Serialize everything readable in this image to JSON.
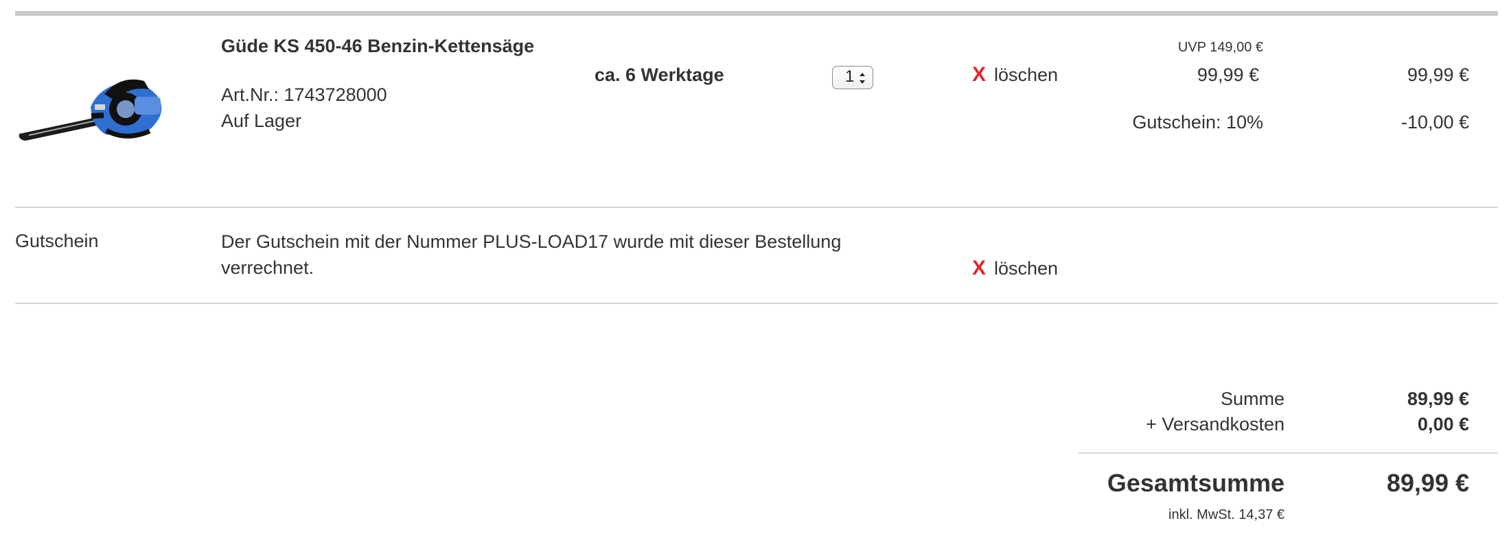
{
  "cart": {
    "item": {
      "title": "Güde KS 450-46 Benzin-Kettensäge",
      "article_number": "Art.Nr.: 1743728000",
      "stock_status": "Auf Lager",
      "delivery_time": "ca. 6 Werktage",
      "quantity": "1",
      "delete_label": "löschen",
      "delete_marker": "X",
      "uvp": "UVP 149,00 €",
      "unit_price": "99,99 €",
      "line_total": "99,99 €",
      "coupon_label": "Gutschein: 10%",
      "coupon_amount": "-10,00 €",
      "image_icon": "chainsaw-product-image"
    },
    "coupon_row": {
      "label": "Gutschein",
      "text": "Der Gutschein mit der Nummer PLUS-LOAD17 wurde mit dieser Bestellung verrechnet.",
      "delete_label": "löschen",
      "delete_marker": "X"
    },
    "summary": {
      "subtotal_label": "Summe",
      "subtotal_value": "89,99 €",
      "shipping_label": "+ Versandkosten",
      "shipping_value": "0,00 €",
      "grand_total_label": "Gesamtsumme",
      "grand_total_value": "89,99 €",
      "vat_note": "inkl. MwSt. 14,37 €"
    }
  },
  "colors": {
    "delete_x": "#e0262b",
    "text": "#333333",
    "divider": "#d6d6d6",
    "top_rule": "#c8c8c8",
    "product_blue": "#2f6fd0"
  }
}
